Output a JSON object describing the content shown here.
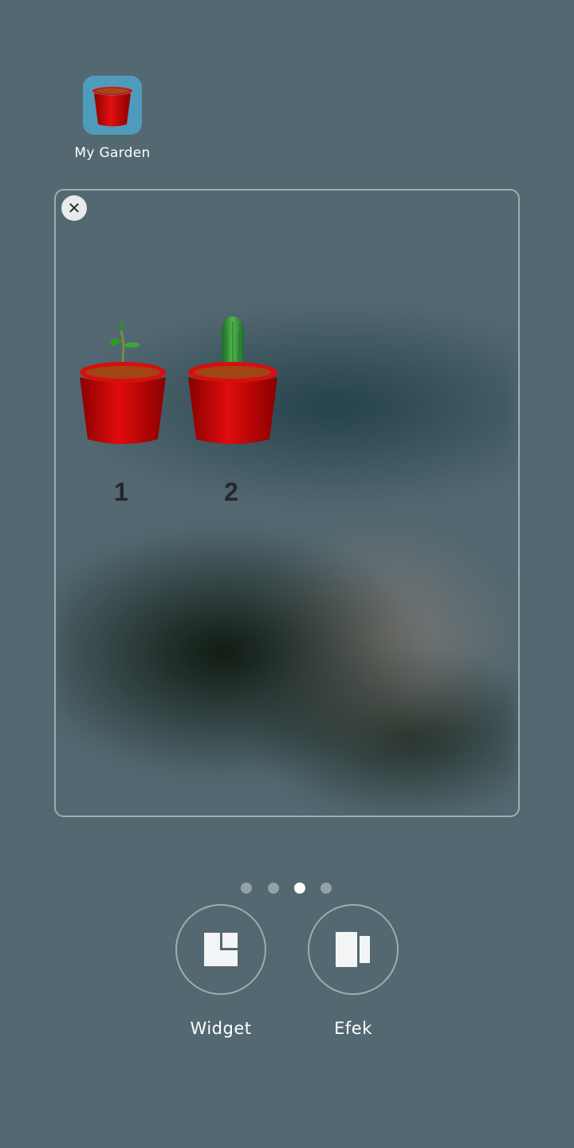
{
  "home": {
    "app": {
      "label": "My Garden",
      "icon": "flower-pot-icon",
      "icon_bg": "#4f9bbb"
    }
  },
  "widget": {
    "close_icon": "close-icon",
    "pots": [
      {
        "number": "1",
        "plant": "sprout-seedling",
        "pot_color": "#cc0000"
      },
      {
        "number": "2",
        "plant": "cactus",
        "pot_color": "#cc0000"
      }
    ]
  },
  "page_indicator": {
    "count": 4,
    "active_index": 2
  },
  "actions": {
    "widget_label": "Widget",
    "widget_icon": "widget-icon",
    "effects_label": "Efek",
    "effects_icon": "effects-icon"
  },
  "colors": {
    "background": "#536871",
    "pot_red": "#cc0000",
    "active_dot": "#ffffff"
  }
}
